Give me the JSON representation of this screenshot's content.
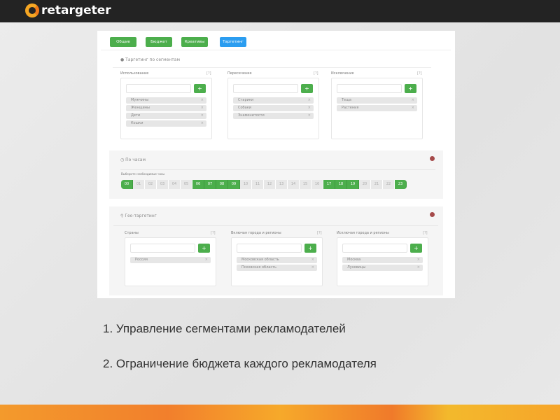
{
  "brand": {
    "name": "retargeter"
  },
  "tabs": [
    "Общие",
    "Бюджет",
    "Креативы",
    "Таргетинг"
  ],
  "active_tab": "Таргетинг",
  "segments": {
    "title": "Таргетинг по сегментам",
    "help": "[?]",
    "add": "+",
    "remove": "×",
    "columns": [
      {
        "label": "Использование",
        "items": [
          "Мужчины",
          "Женщины",
          "Дети",
          "Кошки"
        ]
      },
      {
        "label": "Пересечение",
        "items": [
          "Старики",
          "Собаки",
          "Знаменитости"
        ]
      },
      {
        "label": "Исключение",
        "items": [
          "Теща",
          "Растения"
        ]
      }
    ]
  },
  "hours": {
    "title": "По часам",
    "hint": "Выберите необходимые часы",
    "list": [
      "00",
      "01",
      "02",
      "03",
      "04",
      "05",
      "06",
      "07",
      "08",
      "09",
      "10",
      "11",
      "12",
      "13",
      "14",
      "15",
      "16",
      "17",
      "18",
      "19",
      "20",
      "21",
      "22",
      "23"
    ],
    "selected": [
      "00",
      "06",
      "07",
      "08",
      "09",
      "17",
      "18",
      "19",
      "23"
    ]
  },
  "geo": {
    "title": "Гео-таргетинг",
    "columns": [
      {
        "label": "Страны",
        "items": [
          "Россия"
        ]
      },
      {
        "label": "Включая города и регионы",
        "items": [
          "Московская область",
          "Псковская область"
        ]
      },
      {
        "label": "Исключая города и регионы",
        "items": [
          "Москва",
          "Луховицы"
        ]
      }
    ]
  },
  "points": [
    "1. Управление сегментами рекламодателей",
    "2. Ограничение бюджета каждого рекламодателя"
  ],
  "colors": {
    "green": "#4cae4c",
    "blue": "#2b9df0",
    "orange": "#f39a2c"
  }
}
